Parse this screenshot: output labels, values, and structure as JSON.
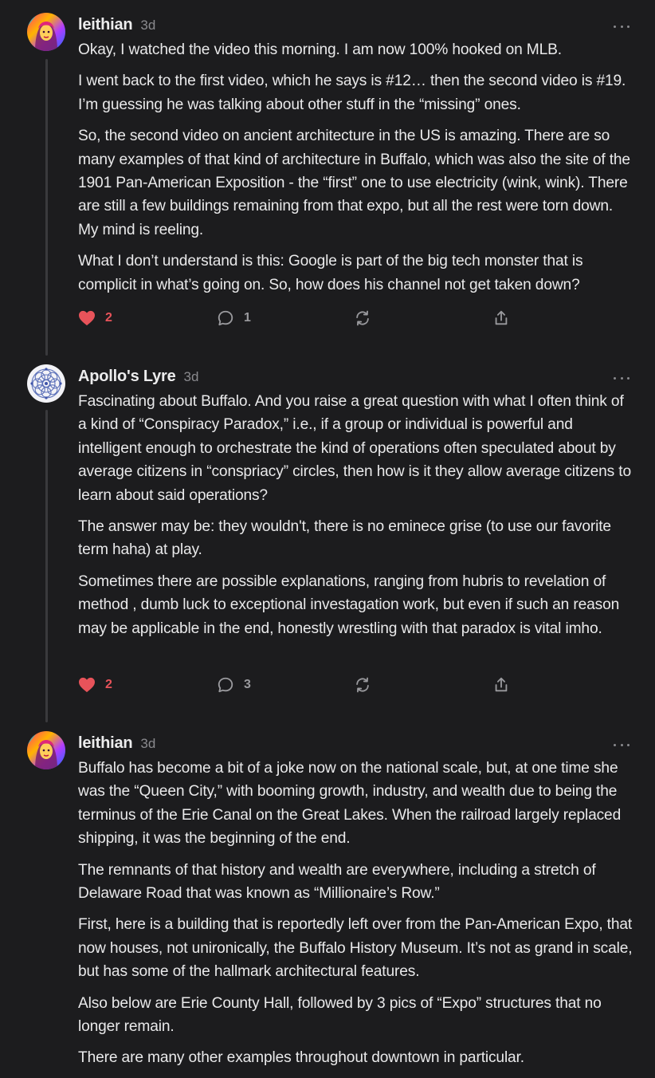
{
  "colors": {
    "background": "#1c1c1e",
    "text": "#e9e9ea",
    "muted": "#8a8a8e",
    "heart": "#e8535a"
  },
  "comments": [
    {
      "author": "leithian",
      "time": "3d",
      "avatar": "colorful-portrait-avatar",
      "paragraphs": [
        "Okay, I watched the video this morning. I am now 100% hooked on MLB.",
        "I went back to the first video, which he says is #12… then the second video is #19. I’m guessing he was talking about other stuff in the “missing” ones.",
        "So, the second video on ancient architecture in the US is amazing. There are so many examples of that kind of architecture in Buffalo, which was also the site of the 1901 Pan-American Exposition - the “first” one to use electricity (wink, wink). There are still a few buildings remaining from that expo, but all the rest were torn down. My mind is reeling.",
        "What I don’t understand is this: Google is part of the big tech monster that is complicit in what’s going on. So, how does his channel not get taken down?"
      ],
      "likes": "2",
      "replies": "1"
    },
    {
      "author": "Apollo's Lyre",
      "time": "3d",
      "avatar": "mandala-avatar",
      "paragraphs": [
        "Fascinating about Buffalo. And you raise a great question with what I often think of a kind of “Conspiracy Paradox,” i.e., if a group or individual is powerful and intelligent enough to orchestrate the kind of operations often speculated about by average citizens in “conspriacy” circles, then how is it they allow average citizens to learn about said operations?",
        "The answer may be: they wouldn't, there is no eminece grise (to use our favorite term haha) at play.",
        "Sometimes there are possible explanations, ranging from hubris to revelation of method , dumb luck to exceptional investagation work, but even if such an reason may be applicable in the end, honestly wrestling with that paradox is vital imho."
      ],
      "likes": "2",
      "replies": "3"
    },
    {
      "author": "leithian",
      "time": "3d",
      "avatar": "colorful-portrait-avatar",
      "paragraphs": [
        "Buffalo has become a bit of a joke now on the national scale, but, at one time she was the “Queen City,” with booming growth, industry, and wealth due to being the terminus of the Erie Canal on the Great Lakes. When the railroad largely replaced shipping, it was the beginning of the end.",
        "The remnants of that history and wealth are everywhere, including a stretch of Delaware Road that was known as “Millionaire’s Row.”",
        "First, here is a building that is reportedly left over from the Pan-American Expo, that now houses, not unironically, the Buffalo History Museum. It’s not as grand in scale, but has some of the hallmark architectural features.",
        "Also below are Erie County Hall, followed by 3 pics of “Expo” structures that no longer remain.",
        "There are many other examples throughout downtown in particular."
      ]
    }
  ]
}
